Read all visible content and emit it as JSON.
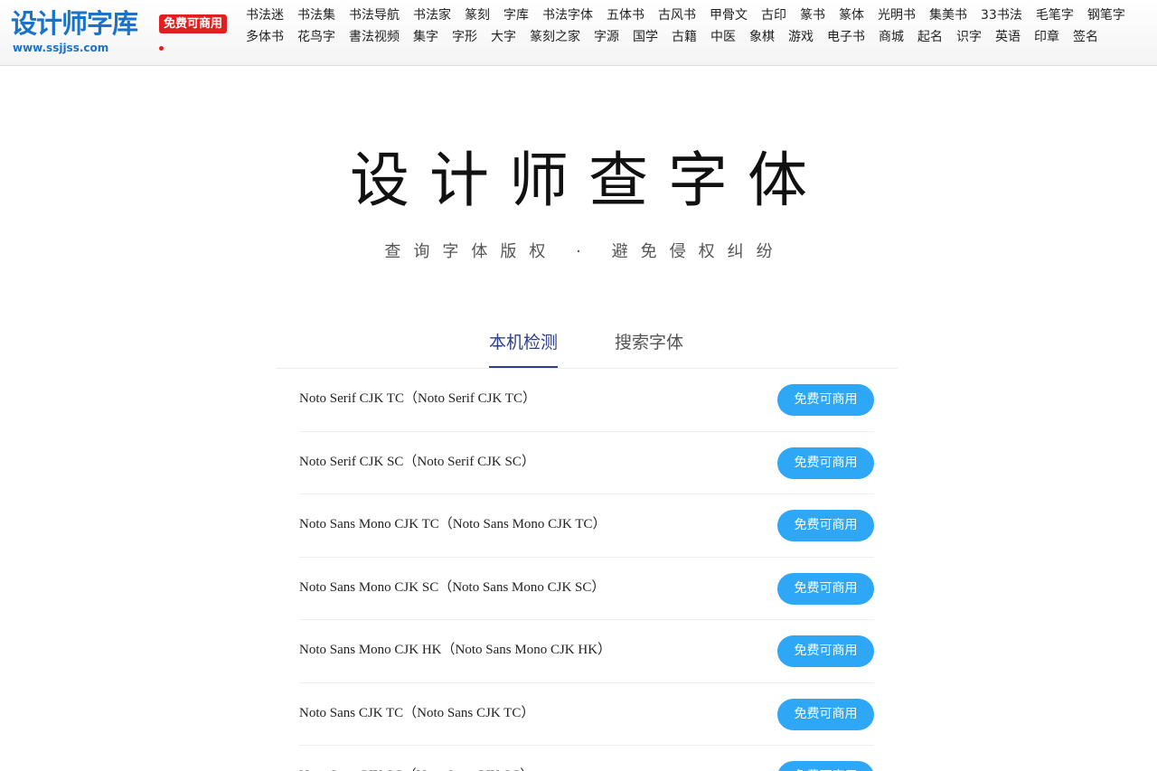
{
  "header": {
    "logo_title": "设计师字库",
    "logo_badge": "免费可商用",
    "logo_url": "www.ssjjss.com",
    "nav_row1": [
      "书法迷",
      "书法集",
      "书法导航",
      "书法家",
      "篆刻",
      "字库",
      "书法字体",
      "五体书",
      "古风书",
      "甲骨文",
      "古印",
      "篆书",
      "篆体",
      "光明书",
      "集美书",
      "33书法",
      "毛笔字",
      "钢笔字"
    ],
    "nav_row2": [
      "多体书",
      "花鸟字",
      "書法视频",
      "集字",
      "字形",
      "大字",
      "篆刻之家",
      "字源",
      "国学",
      "古籍",
      "中医",
      "象棋",
      "游戏",
      "电子书",
      "商城",
      "起名",
      "识字",
      "英语",
      "印章",
      "签名"
    ]
  },
  "hero": {
    "title": "设计师查字体",
    "subtitle": "查询字体版权 · 避免侵权纠纷"
  },
  "tabs": {
    "local_check": "本机检测",
    "search_fonts": "搜索字体"
  },
  "fonts": [
    {
      "name": "Noto Serif CJK TC（Noto Serif CJK TC）",
      "button": "免费可商用"
    },
    {
      "name": "Noto Serif CJK SC（Noto Serif CJK SC）",
      "button": "免费可商用"
    },
    {
      "name": "Noto Sans Mono CJK TC（Noto Sans Mono CJK TC）",
      "button": "免费可商用"
    },
    {
      "name": "Noto Sans Mono CJK SC（Noto Sans Mono CJK SC）",
      "button": "免费可商用"
    },
    {
      "name": "Noto Sans Mono CJK HK（Noto Sans Mono CJK HK）",
      "button": "免费可商用"
    },
    {
      "name": "Noto Sans CJK TC（Noto Sans CJK TC）",
      "button": "免费可商用"
    },
    {
      "name": "Noto Sans CJK SC（Noto Sans CJK SC）",
      "button": "免费可商用"
    }
  ],
  "colors": {
    "brand_blue": "#1a73c8",
    "badge_red": "#e02020",
    "button_blue": "#2ea7f7",
    "active_tab": "#2c3e8c"
  }
}
